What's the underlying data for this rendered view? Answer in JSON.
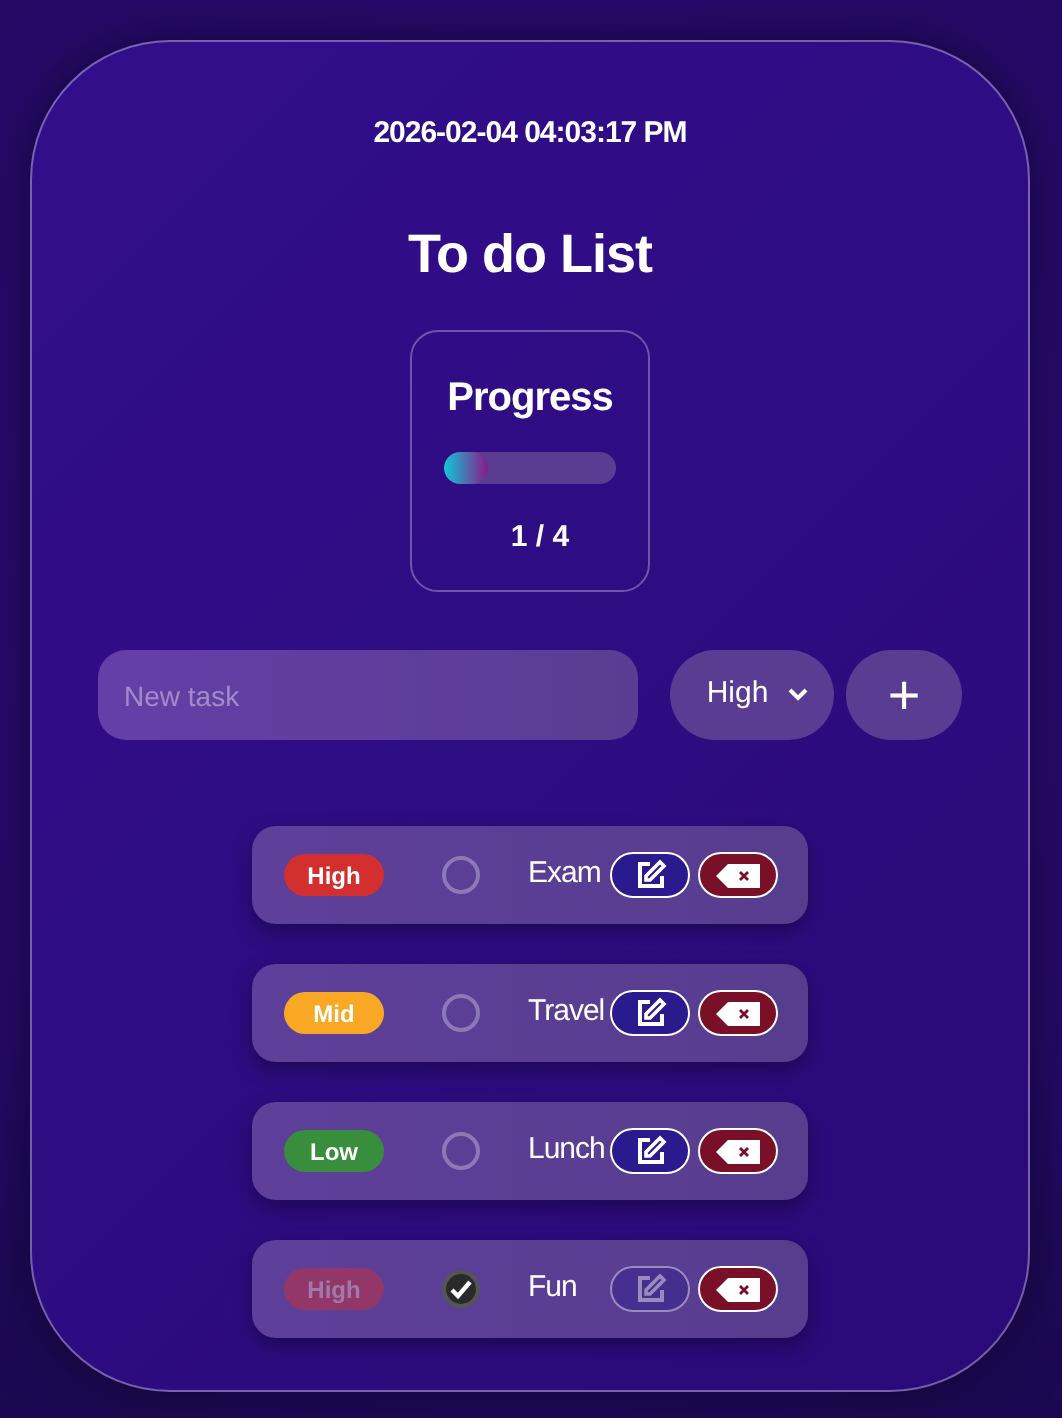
{
  "datetime": "2026-02-04 04:03:17 PM",
  "title": "To do List",
  "progress": {
    "title": "Progress",
    "level": 0.25,
    "count": "1 / 4"
  },
  "new_task": {
    "placeholder": "New task",
    "priority": "High",
    "add": "+"
  },
  "tasks": [
    {
      "kind": "high",
      "badge": "High",
      "name": "Exam",
      "done": false
    },
    {
      "kind": "mid",
      "badge": "Mid",
      "name": "Travel",
      "done": false
    },
    {
      "kind": "low",
      "badge": "Low",
      "name": "Lunch",
      "done": false
    },
    {
      "kind": "high",
      "badge": "High",
      "name": "Fun",
      "done": true
    }
  ]
}
